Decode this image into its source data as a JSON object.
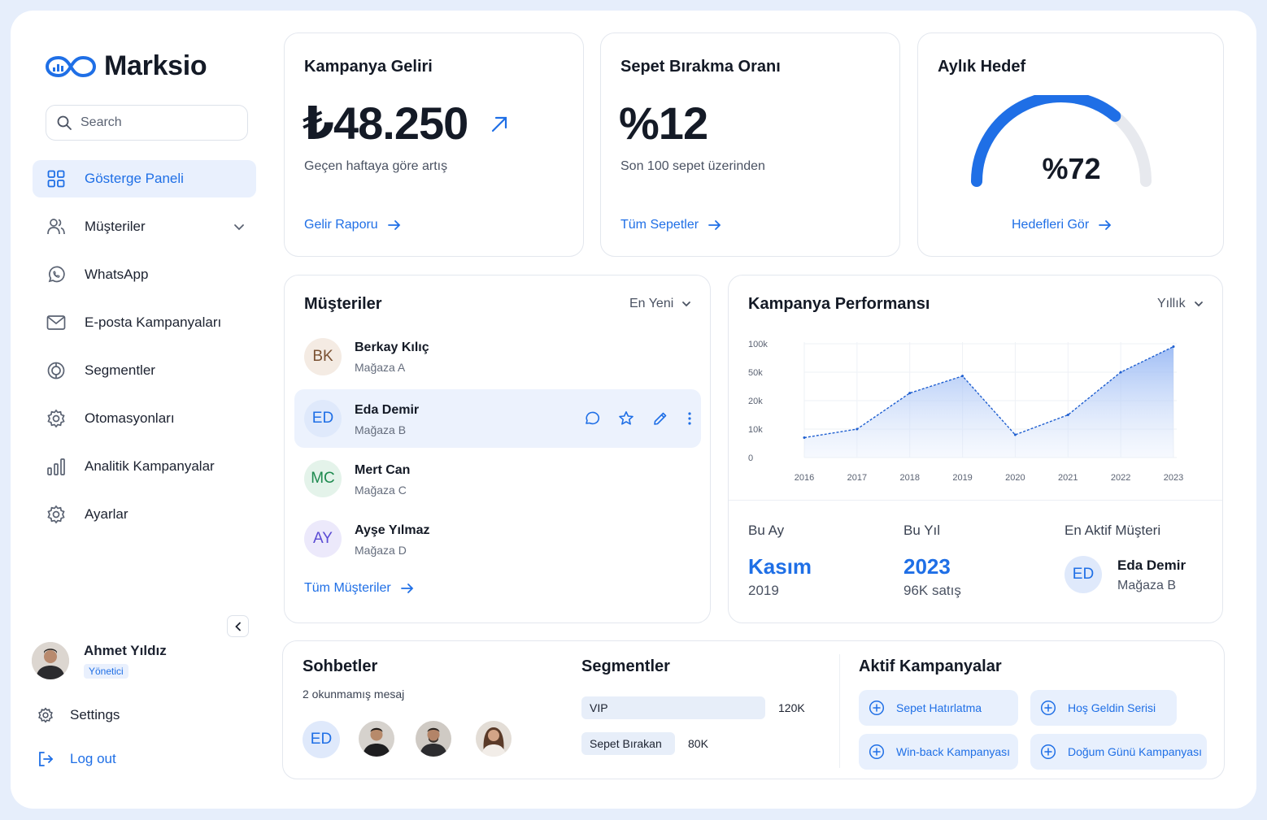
{
  "app": {
    "name": "Marksio"
  },
  "search": {
    "placeholder": "Search"
  },
  "sidebar": {
    "items": [
      {
        "label": "Gösterge Paneli"
      },
      {
        "label": "Müşteriler"
      },
      {
        "label": "WhatsApp"
      },
      {
        "label": "E-posta Kampanyaları"
      },
      {
        "label": "Segmentler"
      },
      {
        "label": "Otomasyonları"
      },
      {
        "label": "Analitik Kampanyalar"
      },
      {
        "label": "Ayarlar"
      }
    ],
    "user": {
      "name": "Ahmet Yıldız",
      "role": "Yönetici"
    },
    "settings_label": "Settings",
    "logout_label": "Log out"
  },
  "revenue": {
    "title": "Kampanya Geliri",
    "value": "₺48.250",
    "subtitle": "Geçen haftaya göre artış",
    "link": "Gelir Raporu"
  },
  "cart": {
    "title": "Sepet Bırakma Oranı",
    "value": "%12",
    "subtitle": "Son 100 sepet üzerinden",
    "link": "Tüm Sepetler"
  },
  "goal": {
    "title": "Aylık Hedef",
    "value": "%72",
    "progress": 0.72,
    "link": "Hedefleri Gör"
  },
  "customers": {
    "title": "Müşteriler",
    "sort": "En Yeni",
    "list": [
      {
        "initials": "BK",
        "name": "Berkay Kılıç",
        "shop": "Mağaza A"
      },
      {
        "initials": "ED",
        "name": "Eda Demir",
        "shop": "Mağaza B"
      },
      {
        "initials": "MC",
        "name": "Mert Can",
        "shop": "Mağaza C"
      },
      {
        "initials": "AY",
        "name": "Ayşe Yılmaz",
        "shop": "Mağaza D"
      }
    ],
    "link": "Tüm Müşteriler"
  },
  "performance": {
    "title": "Kampanya Performansı",
    "period": "Yıllık",
    "stats": {
      "month_label": "Bu Ay",
      "month_value": "Kasım",
      "month_sub": "2019",
      "year_label": "Bu Yıl",
      "year_value": "2023",
      "year_sub": "96K satış",
      "top_label": "En Aktif Müşteri",
      "top_initials": "ED",
      "top_name": "Eda Demir",
      "top_shop": "Mağaza B"
    }
  },
  "chart_data": {
    "type": "area",
    "title": "Kampanya Performansı",
    "x": [
      "2016",
      "2017",
      "2018",
      "2019",
      "2020",
      "2021",
      "2022",
      "2023"
    ],
    "y_ticks": [
      "100k",
      "50k",
      "20k",
      "10k",
      "0"
    ],
    "series": [
      {
        "values": [
          7,
          10,
          28,
          46,
          8,
          15,
          50,
          95
        ]
      }
    ],
    "ylim": [
      0,
      100
    ],
    "grid": true
  },
  "chats": {
    "title": "Sohbetler",
    "subtitle": "2 okunmamış mesaj",
    "initials": "ED"
  },
  "segments": {
    "title": "Segmentler",
    "items": [
      {
        "label": "VIP",
        "value": "120K",
        "ratio": 1.0
      },
      {
        "label": "Sepet Bırakan",
        "value": "80K",
        "ratio": 0.67
      }
    ]
  },
  "campaigns": {
    "title": "Aktif Kampanyalar",
    "items": [
      "Sepet Hatırlatma",
      "Hoş Geldin Serisi",
      "Win-back Kampanyası",
      "Doğum Günü Kampanyası"
    ]
  },
  "colors": {
    "accent": "#1f6fe6",
    "active_bg": "#e9f0fd",
    "page_bg": "#e6eefb"
  }
}
